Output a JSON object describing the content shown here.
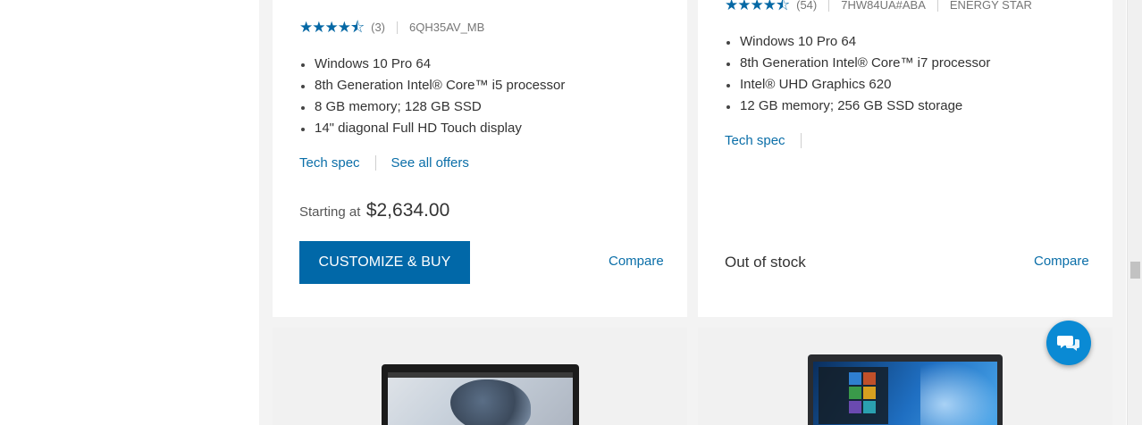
{
  "products": [
    {
      "rating_count": "(3)",
      "sku": "6QH35AV_MB",
      "specs": [
        "Windows 10 Pro 64",
        "8th Generation Intel® Core™ i5 processor",
        "8 GB memory; 128 GB SSD",
        "14\" diagonal Full HD Touch display"
      ],
      "tech_spec_label": "Tech spec",
      "offers_label": "See all offers",
      "price_prefix": "Starting at",
      "price": "$2,634.00",
      "buy_label": "CUSTOMIZE & BUY",
      "compare_label": "Compare",
      "rating": 4.5
    },
    {
      "rating_count": "(54)",
      "sku": "7HW84UA#ABA",
      "badge": "ENERGY STAR",
      "specs": [
        "Windows 10 Pro 64",
        "8th Generation Intel® Core™ i7 processor",
        "Intel® UHD Graphics 620",
        "12 GB memory; 256 GB SSD storage"
      ],
      "tech_spec_label": "Tech spec",
      "stock_status": "Out of stock",
      "compare_label": "Compare",
      "rating": 4.5
    }
  ],
  "icons": {
    "star": "star-icon",
    "chat": "chat-icon"
  },
  "colors": {
    "accent": "#0168a8",
    "link": "#0a6ea8",
    "chat": "#0a8ad4"
  },
  "scrollbar": {
    "position": 0.62
  }
}
